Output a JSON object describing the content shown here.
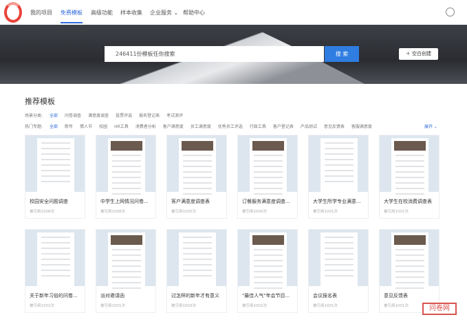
{
  "nav": {
    "items": [
      "我的项目",
      "免费模板",
      "高级功能",
      "样本收集",
      "企业服务",
      "帮助中心"
    ],
    "active": 1
  },
  "search": {
    "placeholder": "246411份模板任你搜索",
    "button": "搜 索",
    "blank": "空白创建"
  },
  "section_title": "推荐模板",
  "filters": {
    "scene_label": "场景分类:",
    "scene": [
      "全部",
      "问卷调查",
      "满意度调查",
      "投票评选",
      "报名登记表",
      "考试测评"
    ],
    "topic_label": "热门专题:",
    "topic": [
      "全部",
      "新年",
      "情人节",
      "校园",
      "HR工具",
      "消费者分析",
      "客户满意度",
      "员工满意度",
      "优秀员工评选",
      "行政工具",
      "客户登记表",
      "产品测试",
      "意见反馈表",
      "客服满意度"
    ],
    "expand": "展开 ⌄"
  },
  "cards": [
    {
      "name": "校园安全问题调查",
      "count": "被引用1008次"
    },
    {
      "name": "中学生上网情况问卷...",
      "count": "被引用1008次"
    },
    {
      "name": "客户满意度调查表",
      "count": "被引用1005次"
    },
    {
      "name": "订餐服务满意度调查...",
      "count": "被引用1000次"
    },
    {
      "name": "大学生所学专业满意...",
      "count": "被引用1001次"
    },
    {
      "name": "大学生在校消费调查表",
      "count": "被引用1001次"
    },
    {
      "name": "关于新年习俗的问卷...",
      "count": "被引用1002次"
    },
    {
      "name": "派对邀请函",
      "count": "被引用1001次"
    },
    {
      "name": "过怎样的新年才有意义",
      "count": "被引用1003次"
    },
    {
      "name": "\"最佳人气\"年会节目...",
      "count": "被引用1002次"
    },
    {
      "name": "会议报名表",
      "count": "被引用1001次"
    },
    {
      "name": "意见反馈表",
      "count": "被引用1001次"
    }
  ],
  "watermark": "问卷网"
}
